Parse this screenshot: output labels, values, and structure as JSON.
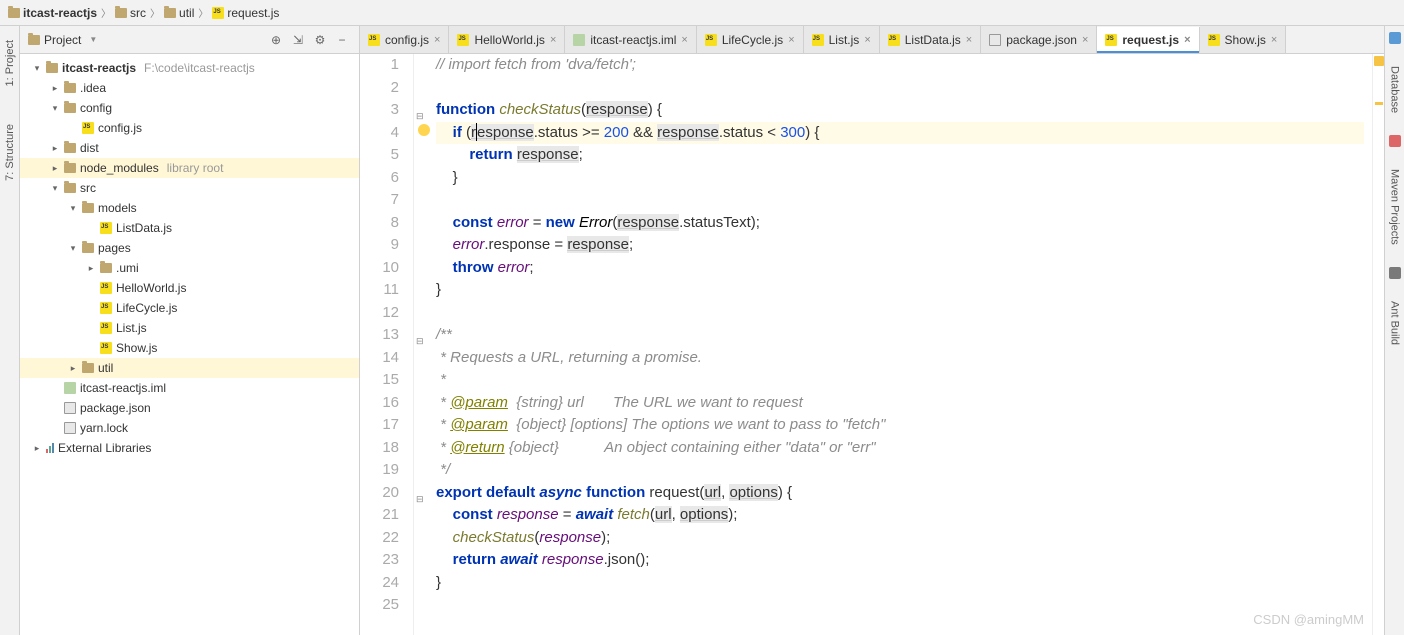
{
  "breadcrumb": [
    {
      "icon": "folder",
      "label": "itcast-reactjs",
      "bold": true
    },
    {
      "icon": "folder",
      "label": "src"
    },
    {
      "icon": "folder",
      "label": "util"
    },
    {
      "icon": "js",
      "label": "request.js"
    }
  ],
  "left_rail": [
    "1: Project",
    "7: Structure"
  ],
  "right_rail": [
    {
      "type": "sq",
      "color": "#5b9bd5",
      "name": "database-icon"
    },
    {
      "type": "tab",
      "label": "Database"
    },
    {
      "type": "sq",
      "color": "#d66",
      "name": "maven-icon"
    },
    {
      "type": "tab",
      "label": "Maven Projects"
    },
    {
      "type": "sq",
      "color": "#7a7a7a",
      "name": "ant-icon"
    },
    {
      "type": "tab",
      "label": "Ant Build"
    }
  ],
  "project_header": {
    "title": "Project",
    "tools": [
      "target-icon",
      "collapse-icon",
      "gear-icon",
      "hide-icon"
    ]
  },
  "tree": [
    {
      "depth": 0,
      "arrow": "▾",
      "icon": "folder",
      "label": "itcast-reactjs",
      "muted": "F:\\code\\itcast-reactjs",
      "bold": true
    },
    {
      "depth": 1,
      "arrow": "▸",
      "icon": "folder",
      "label": ".idea"
    },
    {
      "depth": 1,
      "arrow": "▾",
      "icon": "folder",
      "label": "config"
    },
    {
      "depth": 2,
      "arrow": "",
      "icon": "js",
      "label": "config.js"
    },
    {
      "depth": 1,
      "arrow": "▸",
      "icon": "folder",
      "label": "dist"
    },
    {
      "depth": 1,
      "arrow": "▸",
      "icon": "folder",
      "label": "node_modules",
      "muted": "library root",
      "hl": true
    },
    {
      "depth": 1,
      "arrow": "▾",
      "icon": "folder",
      "label": "src"
    },
    {
      "depth": 2,
      "arrow": "▾",
      "icon": "folder",
      "label": "models"
    },
    {
      "depth": 3,
      "arrow": "",
      "icon": "js",
      "label": "ListData.js"
    },
    {
      "depth": 2,
      "arrow": "▾",
      "icon": "folder",
      "label": "pages"
    },
    {
      "depth": 3,
      "arrow": "▸",
      "icon": "folder",
      "label": ".umi"
    },
    {
      "depth": 3,
      "arrow": "",
      "icon": "js",
      "label": "HelloWorld.js"
    },
    {
      "depth": 3,
      "arrow": "",
      "icon": "js",
      "label": "LifeCycle.js"
    },
    {
      "depth": 3,
      "arrow": "",
      "icon": "js",
      "label": "List.js"
    },
    {
      "depth": 3,
      "arrow": "",
      "icon": "js",
      "label": "Show.js"
    },
    {
      "depth": 2,
      "arrow": "▸",
      "icon": "folder",
      "label": "util",
      "hl": true
    },
    {
      "depth": 1,
      "arrow": "",
      "icon": "iml",
      "label": "itcast-reactjs.iml"
    },
    {
      "depth": 1,
      "arrow": "",
      "icon": "json",
      "label": "package.json"
    },
    {
      "depth": 1,
      "arrow": "",
      "icon": "lock",
      "label": "yarn.lock"
    },
    {
      "depth": 0,
      "arrow": "▸",
      "icon": "lib",
      "label": "External Libraries"
    }
  ],
  "tabs": [
    {
      "icon": "js",
      "label": "config.js"
    },
    {
      "icon": "js",
      "label": "HelloWorld.js"
    },
    {
      "icon": "iml",
      "label": "itcast-reactjs.iml"
    },
    {
      "icon": "js",
      "label": "LifeCycle.js"
    },
    {
      "icon": "js",
      "label": "List.js"
    },
    {
      "icon": "js",
      "label": "ListData.js"
    },
    {
      "icon": "json",
      "label": "package.json"
    },
    {
      "icon": "js",
      "label": "request.js",
      "active": true
    },
    {
      "icon": "js",
      "label": "Show.js"
    }
  ],
  "code": {
    "lines": [
      {
        "n": 1,
        "html": "<span class='cmt'>// import fetch from 'dva/fetch';</span>"
      },
      {
        "n": 2,
        "html": ""
      },
      {
        "n": 3,
        "html": "<span class='kw'>function</span> <span class='fn'>checkStatus</span>(<span class='param under'>response</span>) {",
        "fold": "−"
      },
      {
        "n": 4,
        "hl": true,
        "bulb": true,
        "html": "    <span class='kw'>if</span> (<span class='param under'>r<span class='caret'></span>esponse</span>.status &gt;= <span class='num'>200</span> &amp;&amp; <span class='param under'>response</span>.status &lt; <span class='num'>300</span>) {"
      },
      {
        "n": 5,
        "html": "        <span class='kw'>return</span> <span class='param under'>response</span>;"
      },
      {
        "n": 6,
        "html": "    }"
      },
      {
        "n": 7,
        "html": ""
      },
      {
        "n": 8,
        "html": "    <span class='kw'>const</span> <span class='ident'>error</span> = <span class='kw'>new</span> <span class='cls'><i>Error</i></span>(<span class='param under'>response</span>.statusText);"
      },
      {
        "n": 9,
        "html": "    <span class='ident'>error</span>.response = <span class='param under'>response</span>;"
      },
      {
        "n": 10,
        "html": "    <span class='kw'>throw</span> <span class='ident'>error</span>;"
      },
      {
        "n": 11,
        "html": "}"
      },
      {
        "n": 12,
        "html": ""
      },
      {
        "n": 13,
        "html": "<span class='cmt'>/**</span>",
        "fold": "−"
      },
      {
        "n": 14,
        "html": "<span class='cmt'> * Requests a URL, returning a promise.</span>"
      },
      {
        "n": 15,
        "html": "<span class='cmt'> *</span>"
      },
      {
        "n": 16,
        "html": "<span class='cmt'> * <span class='tag'>@param</span>  {string} url       The URL we want to request</span>"
      },
      {
        "n": 17,
        "html": "<span class='cmt'> * <span class='tag'>@param</span>  {object} [options] The options we want to pass to \"fetch\"</span>"
      },
      {
        "n": 18,
        "html": "<span class='cmt'> * <span class='tag'>@return</span> {object}           An object containing either \"data\" or \"err\"</span>"
      },
      {
        "n": 19,
        "html": "<span class='cmt'> */</span>"
      },
      {
        "n": 20,
        "html": "<span class='kw'>export</span> <span class='kw'>default</span> <span class='kw2'>async</span> <span class='kw'>function</span> request(<span class='param under'>url</span>, <span class='param under'>options</span>) {",
        "fold": "−"
      },
      {
        "n": 21,
        "html": "    <span class='kw'>const</span> <span class='ident'>response</span> = <span class='kw2'>await</span> <span class='fn'>fetch</span>(<span class='param under'>url</span>, <span class='param under'>options</span>);"
      },
      {
        "n": 22,
        "html": "    <span class='fn'>checkStatus</span>(<span class='ident'>response</span>);"
      },
      {
        "n": 23,
        "html": "    <span class='kw'>return</span> <span class='kw2'>await</span> <span class='ident'>response</span>.json();"
      },
      {
        "n": 24,
        "html": "}"
      },
      {
        "n": 25,
        "html": ""
      }
    ]
  },
  "watermark": "CSDN @amingMM"
}
